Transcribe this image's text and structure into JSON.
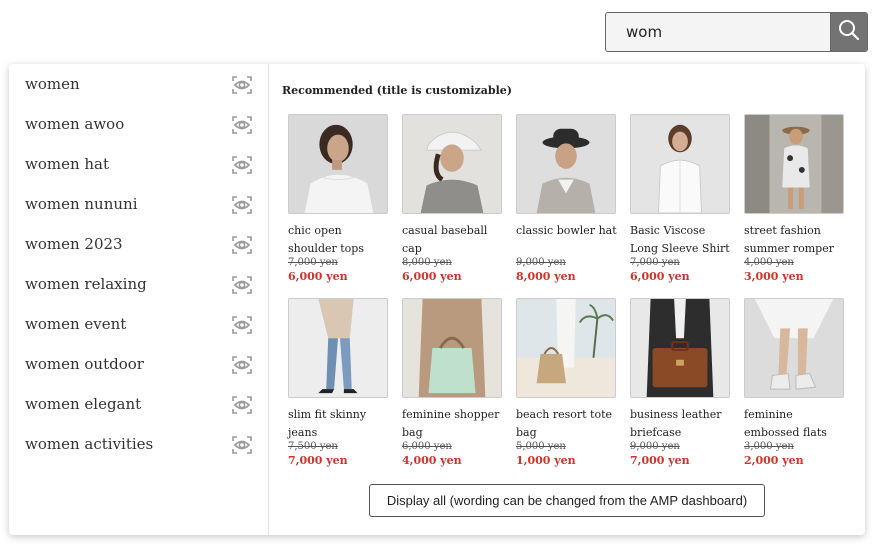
{
  "search": {
    "value": "wom",
    "icon": "search-icon"
  },
  "suggestions": [
    {
      "label": "women"
    },
    {
      "label": "women awoo"
    },
    {
      "label": "women hat"
    },
    {
      "label": "women nununi"
    },
    {
      "label": "women 2023"
    },
    {
      "label": "women relaxing"
    },
    {
      "label": "women event"
    },
    {
      "label": "women outdoor"
    },
    {
      "label": "women elegant"
    },
    {
      "label": "women activities"
    }
  ],
  "recommended": {
    "title": "Recommended (title is customizable)",
    "products": [
      {
        "name": "chic open shoulder tops",
        "old_price": "7,000 yen",
        "price": "6,000 yen"
      },
      {
        "name": "casual baseball cap",
        "old_price": "8,000 yen",
        "price": "6,000 yen"
      },
      {
        "name": "classic bowler hat",
        "old_price": "9,000 yen",
        "price": "8,000 yen"
      },
      {
        "name": "Basic Viscose Long Sleeve Shirt",
        "old_price": "7,000 yen",
        "price": "6,000 yen"
      },
      {
        "name": "street fashion summer romper",
        "old_price": "4,000 yen",
        "price": "3,000 yen"
      },
      {
        "name": "slim fit skinny jeans",
        "old_price": "7,500 yen",
        "price": "7,000 yen"
      },
      {
        "name": "feminine shopper bag",
        "old_price": "6,000 yen",
        "price": "4,000 yen"
      },
      {
        "name": "beach resort tote bag",
        "old_price": "5,000 yen",
        "price": "1,000 yen"
      },
      {
        "name": "business leather briefcase",
        "old_price": "9,000 yen",
        "price": "7,000 yen"
      },
      {
        "name": "feminine embossed flats",
        "old_price": "3,000 yen",
        "price": "2,000 yen"
      }
    ],
    "display_all_label": "Display all (wording can be changed from the AMP dashboard)"
  },
  "colors": {
    "sale_price": "#d0332b",
    "search_button": "#737373"
  }
}
